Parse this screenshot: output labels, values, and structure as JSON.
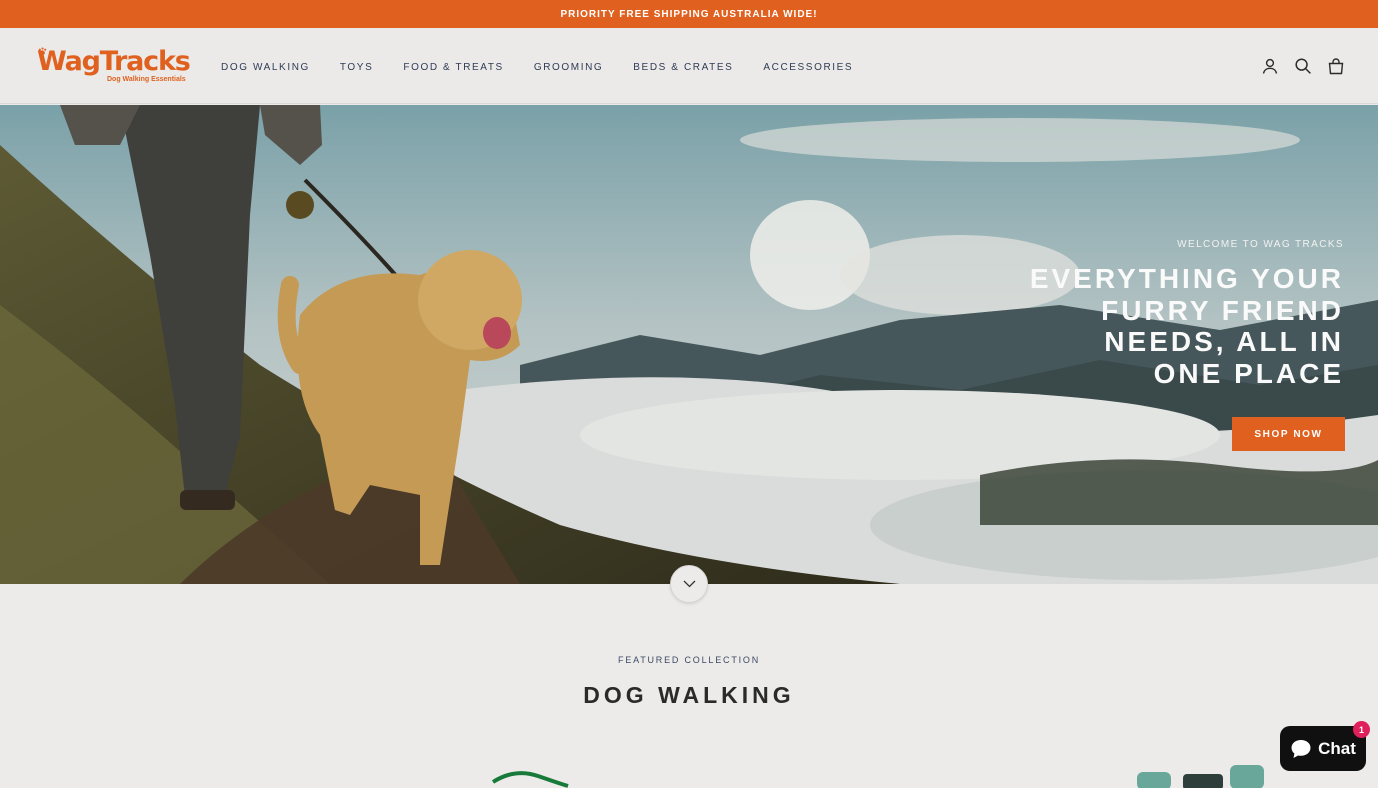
{
  "announcement": {
    "text": "PRIORITY FREE SHIPPING AUSTRALIA WIDE!"
  },
  "brand": {
    "name": "WagTracks",
    "tagline": "Dog Walking Essentials",
    "accent_color": "#e0611f"
  },
  "nav": {
    "items": [
      {
        "label": "DOG WALKING"
      },
      {
        "label": "TOYS"
      },
      {
        "label": "FOOD & TREATS"
      },
      {
        "label": "GROOMING"
      },
      {
        "label": "BEDS & CRATES"
      },
      {
        "label": "ACCESSORIES"
      }
    ]
  },
  "header_icons": [
    "account-icon",
    "search-icon",
    "cart-icon"
  ],
  "hero": {
    "eyebrow": "WELCOME TO WAG TRACKS",
    "title": "EVERYTHING YOUR FURRY FRIEND NEEDS, ALL IN ONE PLACE",
    "button_label": "SHOP NOW"
  },
  "featured": {
    "eyebrow": "FEATURED COLLECTION",
    "title": "DOG WALKING"
  },
  "chat": {
    "label": "Chat",
    "badge_count": "1"
  }
}
